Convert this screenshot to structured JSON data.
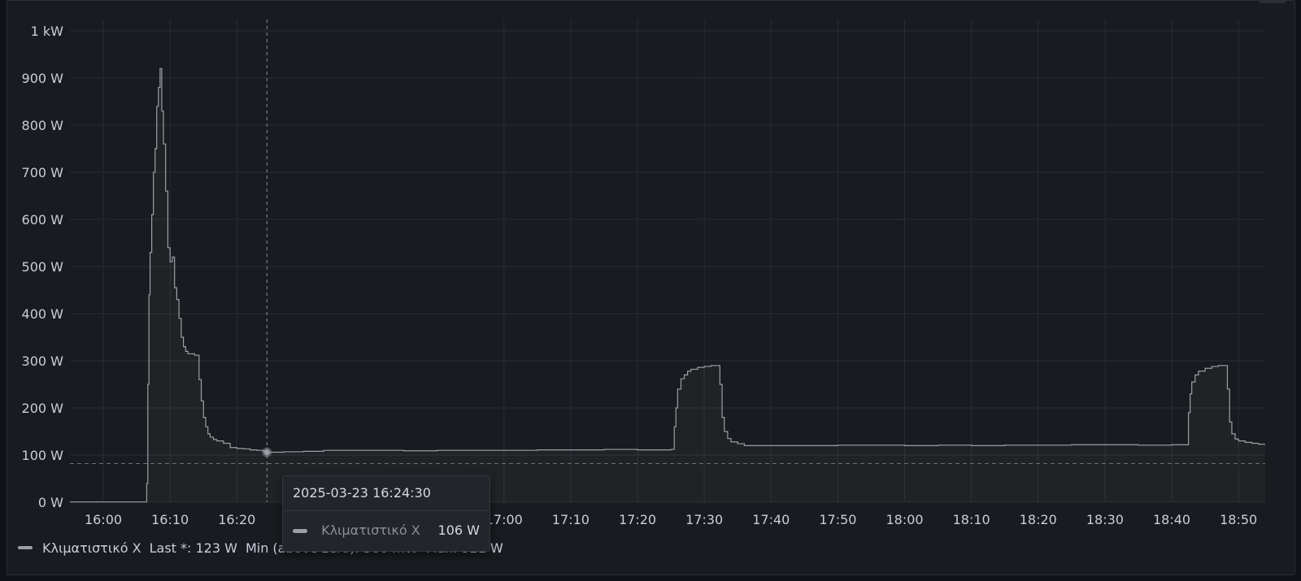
{
  "chart_data": {
    "type": "line",
    "title": "",
    "xlabel": "",
    "ylabel": "",
    "x_unit": "minutes of day",
    "xlim": [
      "15:55",
      "18:54"
    ],
    "ylim": [
      0,
      1000
    ],
    "y_ticks": [
      0,
      100,
      200,
      300,
      400,
      500,
      600,
      700,
      800,
      900,
      1000
    ],
    "y_tick_labels": [
      "0 W",
      "100 W",
      "200 W",
      "300 W",
      "400 W",
      "500 W",
      "600 W",
      "700 W",
      "800 W",
      "900 W",
      "1 kW"
    ],
    "x_ticks": [
      "16:00",
      "16:10",
      "16:20",
      "17:00",
      "17:10",
      "17:20",
      "17:30",
      "17:40",
      "17:50",
      "18:00",
      "18:10",
      "18:20",
      "18:30",
      "18:40",
      "18:50"
    ],
    "grid": true,
    "legend_position": "bottom-left",
    "threshold_line": 82,
    "series": [
      {
        "name": "Κλιματιστικό Χ",
        "color": "#9aa0a6",
        "points": [
          [
            "15:55",
            0.5
          ],
          [
            "16:06",
            0.5
          ],
          [
            "16:06:30",
            40
          ],
          [
            "16:06:40",
            250
          ],
          [
            "16:06:50",
            440
          ],
          [
            "16:07",
            530
          ],
          [
            "16:07:15",
            610
          ],
          [
            "16:07:30",
            700
          ],
          [
            "16:07:45",
            750
          ],
          [
            "16:08",
            840
          ],
          [
            "16:08:15",
            880
          ],
          [
            "16:08:30",
            920
          ],
          [
            "16:08:45",
            830
          ],
          [
            "16:09",
            760
          ],
          [
            "16:09:20",
            660
          ],
          [
            "16:09:40",
            540
          ],
          [
            "16:10",
            510
          ],
          [
            "16:10:20",
            520
          ],
          [
            "16:10:40",
            455
          ],
          [
            "16:11",
            430
          ],
          [
            "16:11:20",
            390
          ],
          [
            "16:11:40",
            350
          ],
          [
            "16:12",
            330
          ],
          [
            "16:12:20",
            320
          ],
          [
            "16:12:40",
            315
          ],
          [
            "16:13",
            315
          ],
          [
            "16:13:40",
            312
          ],
          [
            "16:14",
            312
          ],
          [
            "16:14:20",
            260
          ],
          [
            "16:14:40",
            215
          ],
          [
            "16:15",
            180
          ],
          [
            "16:15:20",
            160
          ],
          [
            "16:15:40",
            145
          ],
          [
            "16:16",
            138
          ],
          [
            "16:16:30",
            133
          ],
          [
            "16:17",
            130
          ],
          [
            "16:18",
            125
          ],
          [
            "16:19",
            116
          ],
          [
            "16:20",
            114
          ],
          [
            "16:21",
            113
          ],
          [
            "16:22",
            111
          ],
          [
            "16:23",
            110
          ],
          [
            "16:24",
            107
          ],
          [
            "16:24:30",
            106
          ],
          [
            "16:27",
            107
          ],
          [
            "16:30",
            108
          ],
          [
            "16:33",
            110
          ],
          [
            "16:40",
            110
          ],
          [
            "16:45",
            109
          ],
          [
            "16:50",
            110
          ],
          [
            "17:00",
            110
          ],
          [
            "17:05",
            111
          ],
          [
            "17:10",
            111
          ],
          [
            "17:15",
            112
          ],
          [
            "17:20",
            111
          ],
          [
            "17:25",
            112
          ],
          [
            "17:25:30",
            160
          ],
          [
            "17:25:45",
            200
          ],
          [
            "17:26",
            240
          ],
          [
            "17:26:30",
            262
          ],
          [
            "17:27",
            270
          ],
          [
            "17:27:30",
            278
          ],
          [
            "17:28",
            282
          ],
          [
            "17:29",
            286
          ],
          [
            "17:30",
            288
          ],
          [
            "17:31",
            290
          ],
          [
            "17:32",
            290
          ],
          [
            "17:32:20",
            250
          ],
          [
            "17:32:40",
            180
          ],
          [
            "17:33",
            150
          ],
          [
            "17:33:30",
            135
          ],
          [
            "17:34",
            128
          ],
          [
            "17:35",
            124
          ],
          [
            "17:36",
            120
          ],
          [
            "17:40",
            120
          ],
          [
            "17:45",
            120
          ],
          [
            "17:50",
            121
          ],
          [
            "17:55",
            121
          ],
          [
            "18:00",
            120
          ],
          [
            "18:05",
            121
          ],
          [
            "18:10",
            120
          ],
          [
            "18:15",
            121
          ],
          [
            "18:20",
            121
          ],
          [
            "18:25",
            122
          ],
          [
            "18:30",
            122
          ],
          [
            "18:35",
            121
          ],
          [
            "18:40",
            122
          ],
          [
            "18:42",
            122
          ],
          [
            "18:42:30",
            190
          ],
          [
            "18:42:45",
            230
          ],
          [
            "18:43",
            255
          ],
          [
            "18:43:30",
            270
          ],
          [
            "18:44",
            278
          ],
          [
            "18:45",
            284
          ],
          [
            "18:46",
            288
          ],
          [
            "18:47",
            290
          ],
          [
            "18:48",
            290
          ],
          [
            "18:48:20",
            240
          ],
          [
            "18:48:40",
            170
          ],
          [
            "18:49",
            145
          ],
          [
            "18:49:30",
            134
          ],
          [
            "18:50",
            130
          ],
          [
            "18:51",
            127
          ],
          [
            "18:52",
            125
          ],
          [
            "18:53",
            123
          ],
          [
            "18:54",
            123
          ]
        ]
      }
    ]
  },
  "legend": {
    "series_name": "Κλιματιστικό Χ",
    "last_label": "Last *: 123 W",
    "min_label": "Min (above zero): 500 mW",
    "max_label": "Max: 921 W"
  },
  "tooltip": {
    "time": "2025-03-23 16:24:30",
    "time_value": "16:24:30",
    "series_name": "Κλιματιστικό Χ",
    "value_label": "106 W",
    "value": 106
  }
}
